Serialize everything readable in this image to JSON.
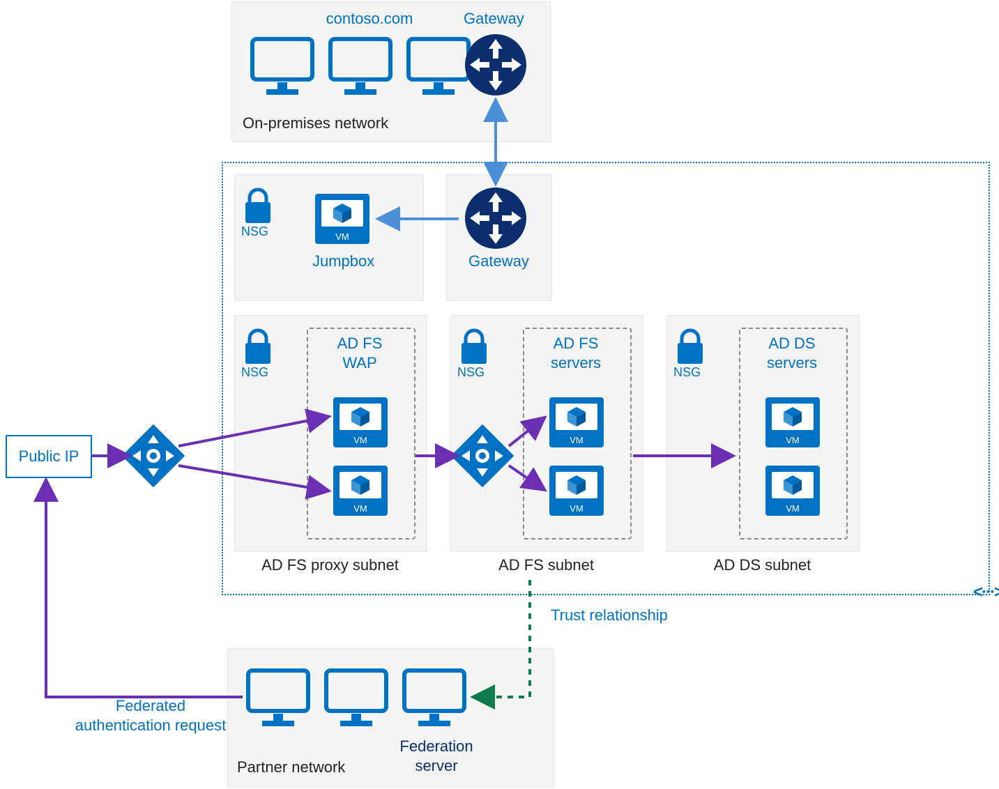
{
  "onprem": {
    "title": "contoso.com",
    "gateway": "Gateway",
    "caption": "On-premises network"
  },
  "azure": {
    "jumpbox": {
      "nsg": "NSG",
      "label": "Jumpbox"
    },
    "gateway": {
      "label": "Gateway"
    },
    "wap": {
      "nsg": "NSG",
      "title_l1": "AD FS",
      "title_l2": "WAP",
      "caption": "AD FS proxy subnet"
    },
    "adfs": {
      "nsg": "NSG",
      "title_l1": "AD FS",
      "title_l2": "servers",
      "caption": "AD FS subnet"
    },
    "adds": {
      "nsg": "NSG",
      "title_l1": "AD DS",
      "title_l2": "servers",
      "caption": "AD DS subnet"
    }
  },
  "public_ip": "Public IP",
  "partner": {
    "caption": "Partner network",
    "fed_l1": "Federation",
    "fed_l2": "server"
  },
  "notes": {
    "trust": "Trust relationship",
    "fed_req_l1": "Federated",
    "fed_req_l2": "authentication request"
  },
  "vm_badge": "VM"
}
